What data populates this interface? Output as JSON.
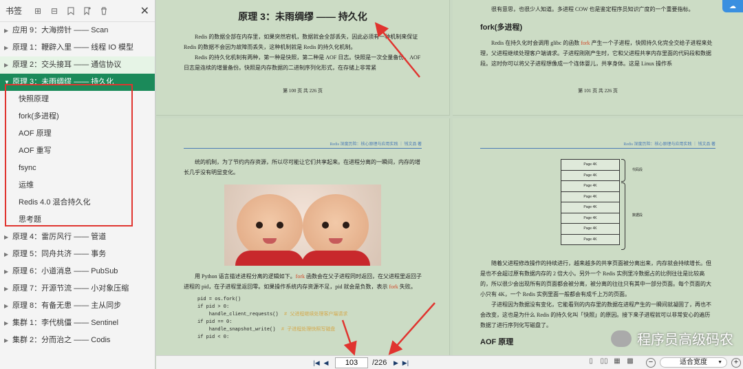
{
  "sidebar": {
    "title": "书签",
    "toc": [
      {
        "label": "应用 9：大海捞针 —— Scan",
        "type": "chapter"
      },
      {
        "label": "原理 1：鞭辟入里 —— 线程 IO 模型",
        "type": "chapter"
      },
      {
        "label": "原理 2：交头接耳 —— 通信协议",
        "type": "chapter"
      },
      {
        "label": "原理 3：未雨绸缪 —— 持久化",
        "type": "chapter"
      },
      {
        "label": "快照原理",
        "type": "sub"
      },
      {
        "label": "fork(多进程)",
        "type": "sub"
      },
      {
        "label": "AOF 原理",
        "type": "sub"
      },
      {
        "label": "AOF 重写",
        "type": "sub"
      },
      {
        "label": "fsync",
        "type": "sub"
      },
      {
        "label": "运维",
        "type": "sub"
      },
      {
        "label": "Redis 4.0 混合持久化",
        "type": "sub"
      },
      {
        "label": "思考题",
        "type": "sub"
      },
      {
        "label": "原理 4：雷厉风行 —— 管道",
        "type": "chapter"
      },
      {
        "label": "原理 5：同舟共济 —— 事务",
        "type": "chapter"
      },
      {
        "label": "原理 6：小道消息 —— PubSub",
        "type": "chapter"
      },
      {
        "label": "原理 7：开源节流 —— 小对象压缩",
        "type": "chapter"
      },
      {
        "label": "原理 8：有备无患 —— 主从同步",
        "type": "chapter"
      },
      {
        "label": "集群 1：李代桃僵 —— Sentinel",
        "type": "chapter"
      },
      {
        "label": "集群 2：分而治之 —— Codis",
        "type": "chapter"
      }
    ]
  },
  "page100": {
    "title": "原理 3：未雨绸缪 —— 持久化",
    "para1": "Redis 的数据全部在内存里，如果突然宕机，数据就会全部丢失，因此必须有一种机制来保证 Redis 的数据不会因为故障而丢失，这种机制就是 Redis 的持久化机制。",
    "para2": "Redis 的持久化机制有两种，第一种是快照，第二种是 AOF 日志。快照是一次全量备份，AOF 日志是连续的增量备份。快照是内存数据的二进制序列化形式，在存储上非常紧",
    "footer": "第 100 页 共 226 页"
  },
  "page101": {
    "top_line": "很有意思，也很少人知道。多进程 COW 也是鉴定程序员知识广度的一个重要指标。",
    "heading": "fork(多进程)",
    "para_a": "Redis 在持久化时会调用 glibc 的函数 ",
    "fork": "fork",
    "para_b": " 产生一个子进程，快照持久化完全交给子进程来处理，父进程继续处理客户端请求。子进程刚刚产生时，它和父进程共享内存里面的代码段和数据段。这时你可以将父子进程想像成一个连体婴儿，共享身体。这是 Linux 操作系",
    "footer": "第 101 页 共 226 页"
  },
  "page102": {
    "header": "Redis 深度历险：核心原理与应用实践 ｜ 钱文品 著",
    "para1": "统的机制，为了节约内存资源，所以尽可能让它们共享起来。在进程分离的一瞬间，内存的增长几乎没有明显变化。",
    "para2_a": "用 Python 语言描述进程分离的逻辑如下。",
    "fork": "fork",
    "para2_b": " 函数会在父子进程同时返回，在父进程里返回子进程的 pid，在子进程里返回零。如果操作系统内存资源不足，pid 就会是负数，表示 ",
    "para2_c": " 失败。",
    "code": [
      {
        "text": "pid = os.fork()",
        "comment": ""
      },
      {
        "text": "if pid > 0:",
        "comment": ""
      },
      {
        "text": "    handle_client_requests()",
        "comment": "# 父进程继续处理客户端请求"
      },
      {
        "text": "if pid == 0:",
        "comment": ""
      },
      {
        "text": "    handle_snapshot_write()",
        "comment": "# 子进程处理快照写磁盘"
      },
      {
        "text": "if pid < 0:",
        "comment": ""
      }
    ]
  },
  "page103": {
    "header": "Redis 深度历险：核心原理与应用实践 ｜ 钱文品 著",
    "blocks": [
      "Page 4K",
      "Page 4K",
      "Page 4K",
      "Page 4K",
      "Page 4K",
      "Page 4K",
      "Page 4K",
      "Page 4K"
    ],
    "code_segment_label": "代码段",
    "data_segment_label": "数据段",
    "para1": "随着父进程修改操作的持续进行，越来越多的共享页面被分离出来，内存就会持续增长。但是也不会超过原有数据内存的 2 倍大小。另外一个 Redis 实例里冷数据占的比例往往是比较高的，所以很少会出现所有的页面都会被分离，被分离的往往只有其中一部分页面。每个页面的大小只有 4K，一个 Redis 实例里面一般都会有成千上万的页面。",
    "para2": "子进程因为数据没有变化，它能看到的内存里的数据在进程产生的一瞬间就凝固了，再也不会改变，这也是为什么 Redis 的持久化叫「快照」的原因。接下来子进程就可以非常安心的遍历数据了进行序列化写磁盘了。",
    "heading": "AOF 原理"
  },
  "watermark": "程序员高级码农",
  "statusbar": {
    "current_page": "103",
    "total_pages": "/226",
    "zoom_mode": "适合宽度"
  },
  "colors": {
    "active": "#1b8a5a",
    "annotation": "#e0342f",
    "page_bg": "#ccdcc5"
  }
}
